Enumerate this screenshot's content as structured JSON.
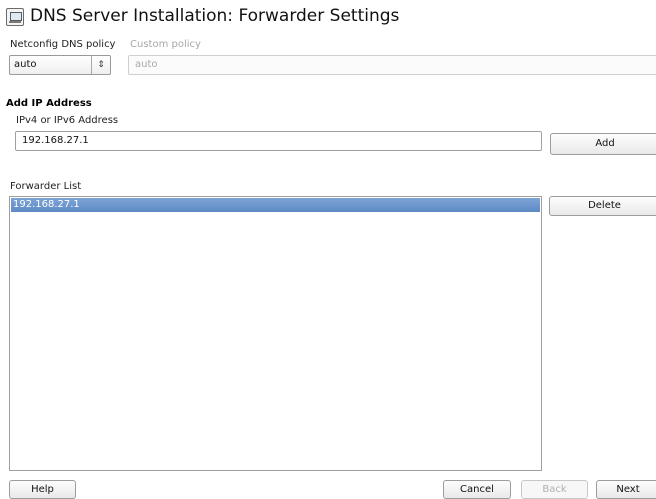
{
  "window": {
    "title": "DNS Server Installation: Forwarder Settings",
    "icon": "dns-server-icon"
  },
  "netconfig": {
    "policy_label": "Netconfig DNS policy",
    "policy_value": "auto",
    "custom_label": "Custom policy",
    "custom_value": "auto"
  },
  "add_ip": {
    "heading": "Add IP Address",
    "address_label": "IPv4 or IPv6 Address",
    "address_value": "192.168.27.1",
    "add_button": "Add"
  },
  "forwarder_list": {
    "label": "Forwarder List",
    "items": [
      "192.168.27.1"
    ],
    "delete_button": "Delete"
  },
  "footer": {
    "help": "Help",
    "cancel": "Cancel",
    "back": "Back",
    "next": "Next"
  },
  "colors": {
    "selection": "#5d89c4",
    "disabled_text": "#a8a8a8"
  }
}
